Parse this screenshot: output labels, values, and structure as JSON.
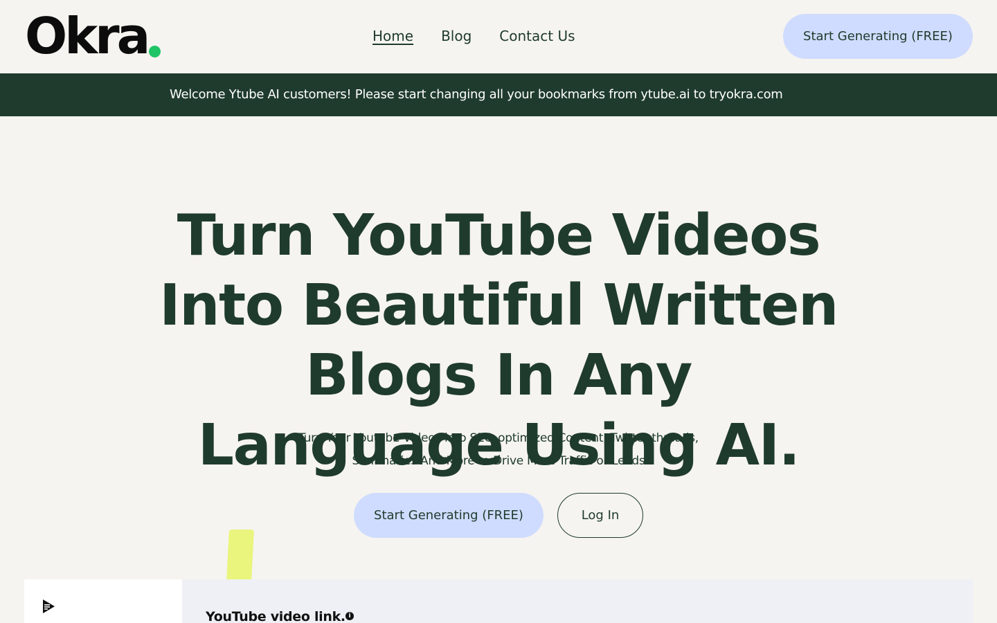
{
  "nav": {
    "logo_text": "Okra",
    "links": [
      {
        "label": "Home",
        "active": true
      },
      {
        "label": "Blog",
        "active": false
      },
      {
        "label": "Contact Us",
        "active": false
      }
    ],
    "cta_label": "Start Generating (FREE)"
  },
  "banner": {
    "text": "Welcome Ytube AI customers!  Please start changing all your bookmarks from ytube.ai to tryokra.com"
  },
  "hero": {
    "title": "Turn YouTube Videos Into Beautiful Written Blogs In Any Language Using AI.",
    "subtitle_line1": "Turn Your Youtube Videos into SEO-optimized Content, Twitter threads,",
    "subtitle_line2": "Summaries And More to Drive More Traffic or Leads",
    "primary_cta": "Start Generating (FREE)",
    "secondary_cta": "Log In"
  },
  "preview": {
    "field_label": "YouTube video link.",
    "info_glyph": "i"
  },
  "colors": {
    "page_bg": "#f6f4f0",
    "brand_dark_green": "#1f3b2d",
    "accent_blue": "#cfdcff",
    "logo_dot": "#1fc467",
    "highlighter": "#e9f57c"
  },
  "icons": {
    "logo_dot": "logo-dot-icon",
    "preview_brand": "play-doc-icon",
    "info": "info-icon"
  }
}
